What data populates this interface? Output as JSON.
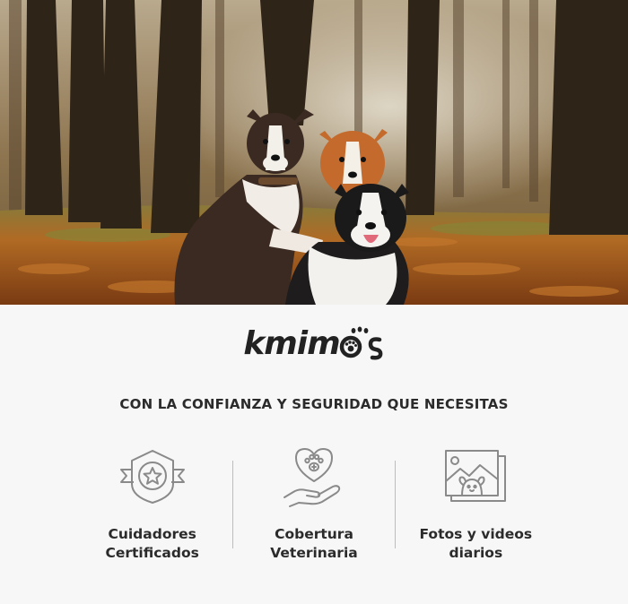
{
  "brand": {
    "name": "kmim",
    "suffix_icon": "paw-print-logo-icon"
  },
  "tagline": "CON LA CONFIANZA Y SEGURIDAD QUE NECESITAS",
  "features": [
    {
      "icon": "certificate-star-badge-icon",
      "line1": "Cuidadores",
      "line2": "Certificados"
    },
    {
      "icon": "heart-paw-hand-icon",
      "line1": "Cobertura",
      "line2": "Veterinaria"
    },
    {
      "icon": "photo-gallery-dog-icon",
      "line1": "Fotos y videos",
      "line2": "diarios"
    }
  ],
  "hero": {
    "subject": "three dogs in autumn forest"
  },
  "colors": {
    "text": "#2b2b2b",
    "icon": "#8a8a8a",
    "background": "#f7f7f7"
  }
}
